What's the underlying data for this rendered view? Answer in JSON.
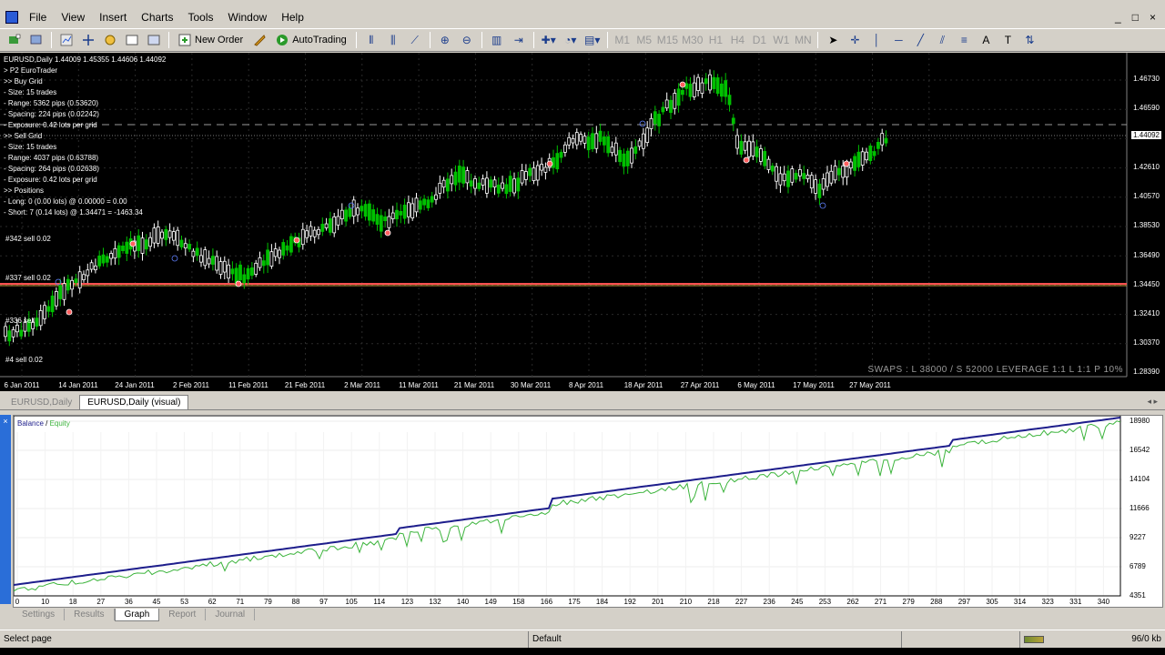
{
  "menu": {
    "items": [
      "File",
      "View",
      "Insert",
      "Charts",
      "Tools",
      "Window",
      "Help"
    ],
    "mdi_controls": [
      "_",
      "□",
      "×"
    ]
  },
  "toolbar": {
    "new_order_label": "New Order",
    "autotrading_label": "AutoTrading"
  },
  "chart": {
    "symbol_line": "EURUSD,Daily  1.44009 1.45355 1.44606 1.44092",
    "info_lines": [
      "> P2 EuroTrader",
      ">> Buy Grid",
      "- Size: 15 trades",
      "- Range: 5362 pips (0.53620)",
      "- Spacing: 224 pips (0.02242)",
      "- Exposure: 0.42 lots per grid",
      ">> Sell Grid",
      "- Size: 15 trades",
      "- Range: 4037 pips (0.63788)",
      "- Spacing: 264 pips (0.02638)",
      "- Exposure: 0.42 lots per grid",
      ">> Positions",
      "- Long: 0 (0.00 lots) @ 0.00000 = 0.00",
      "- Short: 7 (0.14 lots) @ 1.34471 = -1463.34"
    ],
    "current_price": "1.44092",
    "price_labels": [
      "1.46730",
      "1.46590",
      "1.42610",
      "1.40570",
      "1.38530",
      "1.36490",
      "1.34450",
      "1.32410",
      "1.30370",
      "1.28390"
    ],
    "date_labels": [
      "6 Jan 2011",
      "14 Jan 2011",
      "24 Jan 2011",
      "2 Feb 2011",
      "11 Feb 2011",
      "21 Feb 2011",
      "2 Mar 2011",
      "11 Mar 2011",
      "21 Mar 2011",
      "30 Mar 2011",
      "8 Apr 2011",
      "18 Apr 2011",
      "27 Apr 2011",
      "6 May 2011",
      "17 May 2011",
      "27 May 2011"
    ],
    "order_labels": [
      "#342 sell 0.02",
      "#337 sell 0.02",
      "#336 sell",
      "#4 sell 0.02"
    ],
    "swaps_text": "SWAPS : L 38000 / S 52000 LEVERAGE 1:1 L 1:1 P 10%"
  },
  "chart_tabs": [
    "EURUSD,Daily",
    "EURUSD,Daily (visual)"
  ],
  "tester": {
    "close_glyph": "×",
    "legend_balance": "Balance",
    "legend_sep": " / ",
    "legend_equity": "Equity",
    "y_labels": [
      "18980",
      "16542",
      "14104",
      "11666",
      "9227",
      "6789",
      "4351"
    ],
    "x_labels": [
      "0",
      "10",
      "18",
      "27",
      "36",
      "45",
      "53",
      "62",
      "71",
      "79",
      "88",
      "97",
      "105",
      "114",
      "123",
      "132",
      "140",
      "149",
      "158",
      "166",
      "175",
      "184",
      "192",
      "201",
      "210",
      "218",
      "227",
      "236",
      "245",
      "253",
      "262",
      "271",
      "279",
      "288",
      "297",
      "305",
      "314",
      "323",
      "331",
      "340"
    ],
    "tabs": [
      "Settings",
      "Results",
      "Graph",
      "Report",
      "Journal"
    ],
    "active_tab": "Graph"
  },
  "status": {
    "message": "Select page",
    "profile": "Default",
    "traffic": "96/0 kb"
  },
  "colors": {
    "balance_line": "#1e1e8c",
    "equity_line": "#3cb43c",
    "short_line": "#ff4040",
    "bull_candle": "#ffffff",
    "bear_candle": "#00c000"
  }
}
